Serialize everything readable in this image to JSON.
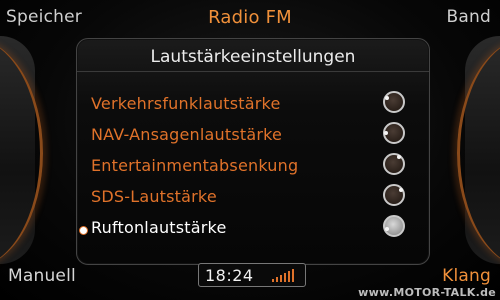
{
  "header": {
    "left_softkey": "Speicher",
    "title": "Radio FM",
    "right_softkey": "Band"
  },
  "panel": {
    "title": "Lautstärkeeinstellungen",
    "items": [
      {
        "label": "Verkehrsfunklautstärke",
        "selected": false
      },
      {
        "label": "NAV-Ansagenlautstärke",
        "selected": false
      },
      {
        "label": "Entertainmentabsenkung",
        "selected": false
      },
      {
        "label": "SDS-Lautstärke",
        "selected": false
      },
      {
        "label": "Ruftonlautstärke",
        "selected": true
      }
    ]
  },
  "footer": {
    "left_softkey": "Manuell",
    "clock": "18:24",
    "right_softkey": "Klang"
  },
  "watermark": "www.MOTOR-TALK.de",
  "colors": {
    "accent": "#e0722a",
    "text": "#ececec",
    "background": "#050505"
  }
}
